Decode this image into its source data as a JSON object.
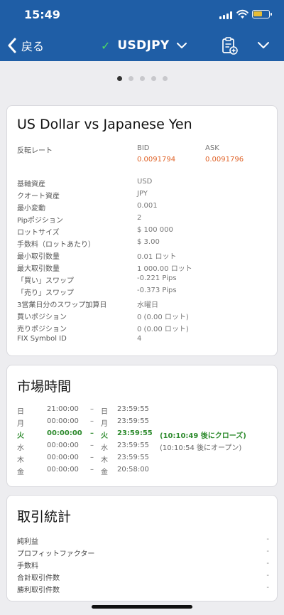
{
  "status": {
    "time": "15:49"
  },
  "nav": {
    "back_label": "戻る",
    "symbol": "USDJPY"
  },
  "pager": {
    "count": 5,
    "active": 1
  },
  "spec": {
    "title": "US Dollar vs Japanese Yen",
    "rate_label": "反転レート",
    "bid_label": "BID",
    "bid_value": "0.0091794",
    "ask_label": "ASK",
    "ask_value": "0.0091796",
    "rows": [
      {
        "label": "基軸資産",
        "value": "USD"
      },
      {
        "label": "クオート資産",
        "value": "JPY"
      },
      {
        "label": "最小変動",
        "value": "0.001"
      },
      {
        "label": "Pipポジション",
        "value": "2"
      },
      {
        "label": "ロットサイズ",
        "value": "$ 100 000"
      },
      {
        "label": "手数料（ロットあたり）",
        "value": "$ 3.00"
      },
      {
        "label": "最小取引数量",
        "value": "0.01 ロット"
      },
      {
        "label": "最大取引数量",
        "value": "1 000.00 ロット"
      },
      {
        "label": "「買い」スワップ",
        "value": "-0.221 Pips"
      },
      {
        "label": "「売り」スワップ",
        "value": "-0.373 Pips"
      },
      {
        "label": "3営業日分のスワップ加算日",
        "value": "水曜日"
      },
      {
        "label": "買いポジション",
        "value": "0 (0.00 ロット)"
      },
      {
        "label": "売りポジション",
        "value": "0 (0.00 ロット)"
      },
      {
        "label": "FIX Symbol ID",
        "value": "4"
      }
    ]
  },
  "market": {
    "title": "市場時間",
    "rows": [
      {
        "day1": "日",
        "t1": "21:00:00",
        "sep": "–",
        "day2": "日",
        "t2": "23:59:55",
        "note": ""
      },
      {
        "day1": "月",
        "t1": "00:00:00",
        "sep": "–",
        "day2": "月",
        "t2": "23:59:55",
        "note": ""
      },
      {
        "day1": "火",
        "t1": "00:00:00",
        "sep": "–",
        "day2": "火",
        "t2": "23:59:55",
        "note": "(10:10:49 後にクローズ)"
      },
      {
        "day1": "水",
        "t1": "00:00:00",
        "sep": "–",
        "day2": "水",
        "t2": "23:59:55",
        "note": "(10:10:54 後にオープン)"
      },
      {
        "day1": "木",
        "t1": "00:00:00",
        "sep": "–",
        "day2": "木",
        "t2": "23:59:55",
        "note": ""
      },
      {
        "day1": "金",
        "t1": "00:00:00",
        "sep": "–",
        "day2": "金",
        "t2": "20:58:00",
        "note": ""
      }
    ]
  },
  "stats": {
    "title": "取引統計",
    "rows": [
      {
        "label": "純利益",
        "value": "-"
      },
      {
        "label": "プロフィットファクター",
        "value": "-"
      },
      {
        "label": "手数料",
        "value": "-"
      },
      {
        "label": "合計取引件数",
        "value": "-"
      },
      {
        "label": "勝利取引件数",
        "value": "-"
      }
    ]
  },
  "colors": {
    "header": "#1f5ea6",
    "rate": "#e0642a",
    "active_session": "#2e8b2e",
    "online": "#4cd964"
  }
}
